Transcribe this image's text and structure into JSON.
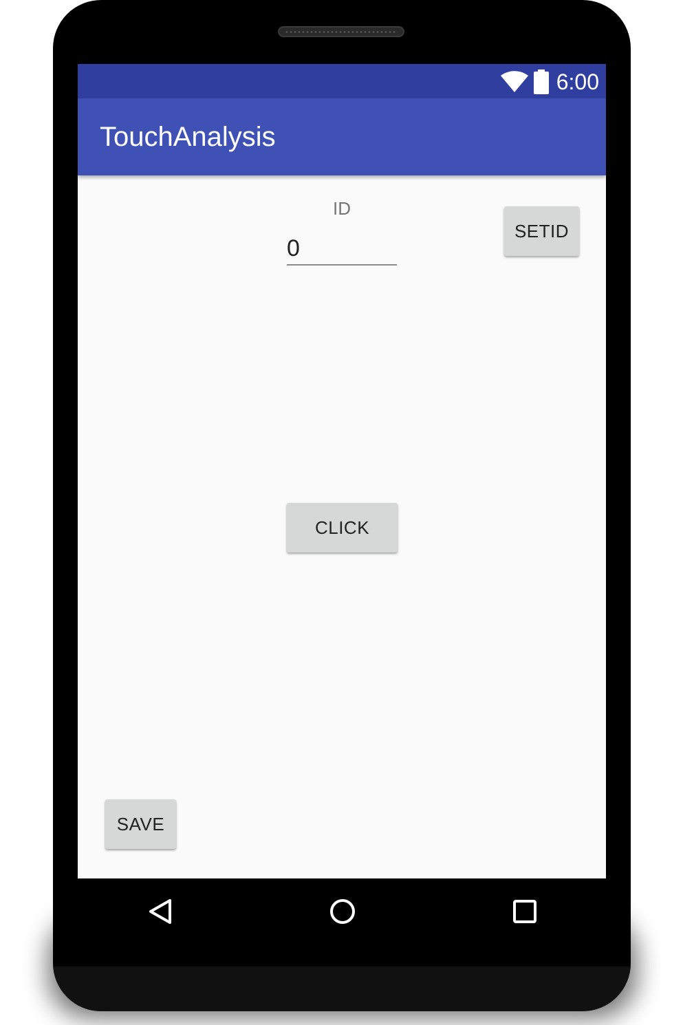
{
  "status_bar": {
    "time": "6:00",
    "icons": [
      "wifi-icon",
      "battery-icon"
    ],
    "color": "#303f9f"
  },
  "app_bar": {
    "title": "TouchAnalysis",
    "color": "#3f51b5"
  },
  "main": {
    "id_label": "ID",
    "id_value": "0",
    "setid_button": "SETID",
    "click_button": "CLICK",
    "save_button": "SAVE"
  },
  "nav_bar": {
    "icons": [
      "back-icon",
      "home-icon",
      "recents-icon"
    ]
  },
  "colors": {
    "screen_background": "#fafafa",
    "button_background": "#d6d7d7",
    "device_frame": "#000000"
  }
}
